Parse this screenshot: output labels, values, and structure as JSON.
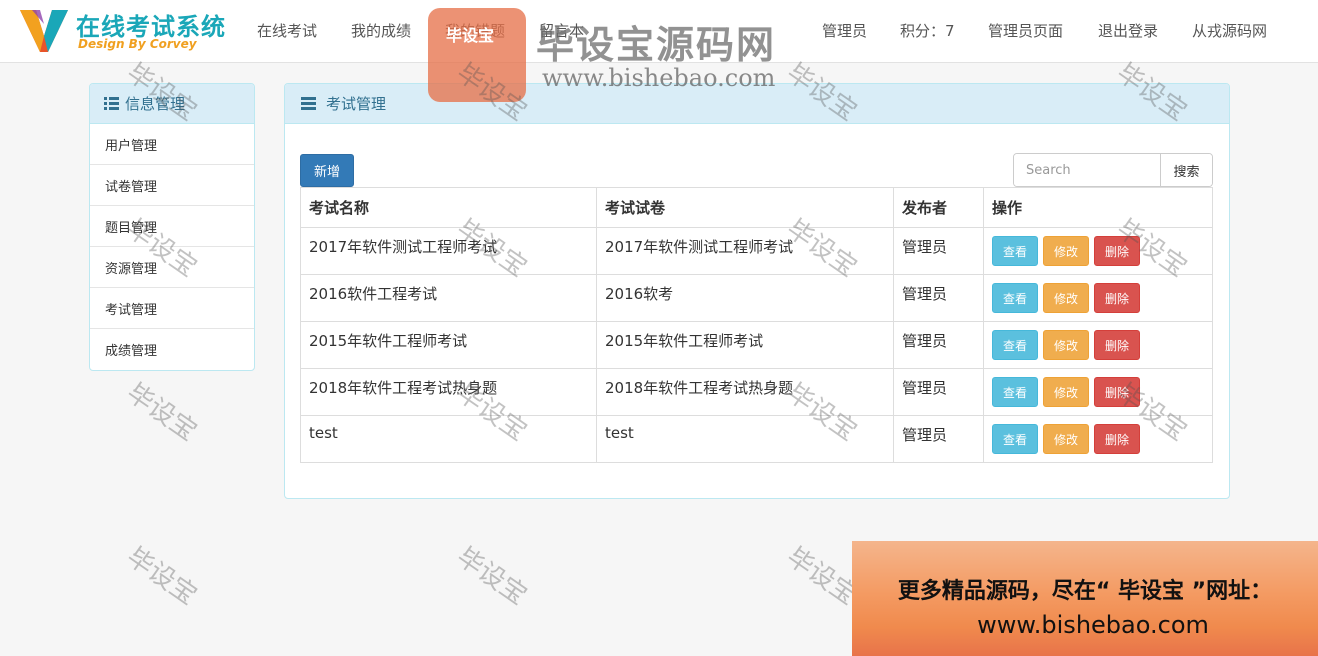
{
  "brand": {
    "title": "在线考试系统",
    "subtitle": "Design By Corvey"
  },
  "nav": {
    "items": [
      {
        "label": "在线考试"
      },
      {
        "label": "我的成绩"
      },
      {
        "label": "我的错题"
      },
      {
        "label": "留言本"
      }
    ],
    "right": [
      {
        "label": "管理员"
      },
      {
        "label": "积分：7"
      },
      {
        "label": "管理员页面"
      },
      {
        "label": "退出登录"
      },
      {
        "label": "从戎源码网"
      }
    ]
  },
  "sidebar": {
    "title": "信息管理",
    "items": [
      {
        "label": "用户管理"
      },
      {
        "label": "试卷管理"
      },
      {
        "label": "题目管理"
      },
      {
        "label": "资源管理"
      },
      {
        "label": "考试管理"
      },
      {
        "label": "成绩管理"
      }
    ]
  },
  "main": {
    "title": "考试管理",
    "add_label": "新增",
    "search": {
      "placeholder": "Search",
      "value": "",
      "button": "搜索"
    },
    "columns": [
      "考试名称",
      "考试试卷",
      "发布者",
      "操作"
    ],
    "actions": {
      "view": "查看",
      "edit": "修改",
      "delete": "删除"
    },
    "rows": [
      {
        "name": "2017年软件测试工程师考试",
        "paper": "2017年软件测试工程师考试",
        "publisher": "管理员"
      },
      {
        "name": "2016软件工程考试",
        "paper": "2016软考",
        "publisher": "管理员"
      },
      {
        "name": "2015年软件工程师考试",
        "paper": "2015年软件工程师考试",
        "publisher": "管理员"
      },
      {
        "name": "2018年软件工程考试热身题",
        "paper": "2018年软件工程考试热身题",
        "publisher": "管理员"
      },
      {
        "name": "test",
        "paper": "test",
        "publisher": "管理员"
      }
    ]
  },
  "watermark": {
    "text": "毕设宝",
    "logo_badge": "毕设宝",
    "logo_title": "毕设宝源码网",
    "logo_url": "www.bishebao.com"
  },
  "banner": {
    "line1": "更多精品源码，尽在“ 毕设宝 ”网址：",
    "line2": "www.bishebao.com"
  },
  "colors": {
    "primary": "#337ab7",
    "info": "#5bc0de",
    "warning": "#f0ad4e",
    "danger": "#d9534f",
    "panel_heading": "#d9edf7",
    "brand_teal": "#1aa7b8"
  }
}
